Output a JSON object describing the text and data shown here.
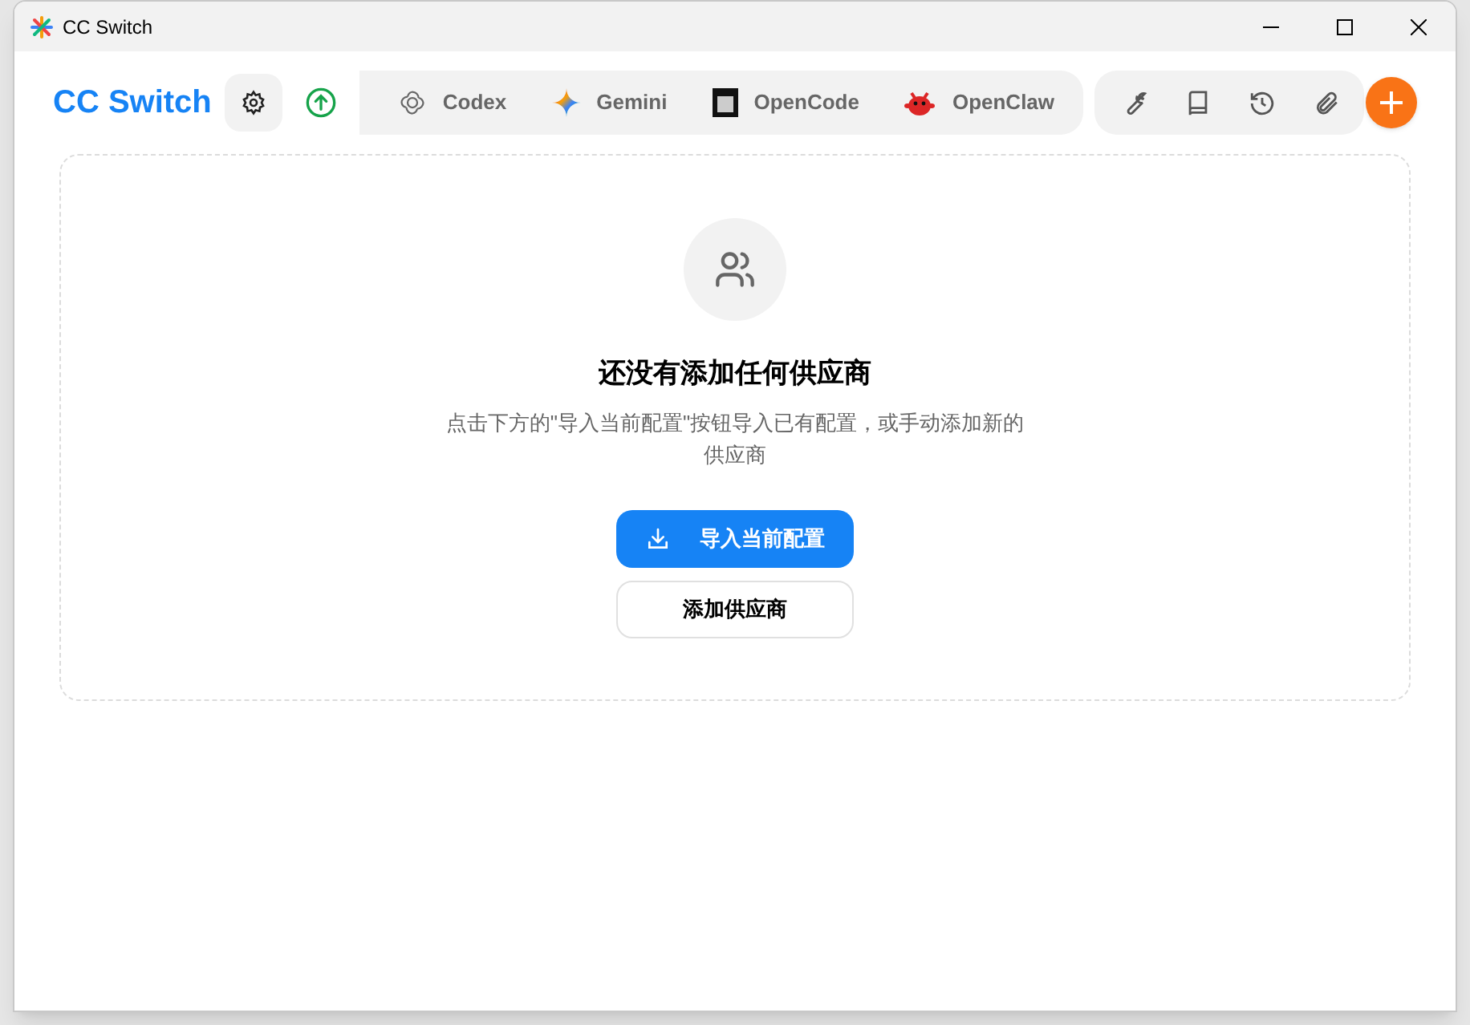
{
  "window": {
    "title": "CC Switch"
  },
  "header": {
    "logo": "CC Switch",
    "tabs": [
      {
        "label": "Codex",
        "kind": "codex"
      },
      {
        "label": "Gemini",
        "kind": "gemini"
      },
      {
        "label": "OpenCode",
        "kind": "opencode"
      },
      {
        "label": "OpenClaw",
        "kind": "openclaw"
      }
    ]
  },
  "empty_state": {
    "title": "还没有添加任何供应商",
    "description": "点击下方的\"导入当前配置\"按钮导入已有配置，或手动添加新的供应商",
    "buttons": [
      {
        "label": "导入当前配置",
        "kind": "primary"
      },
      {
        "label": "添加供应商",
        "kind": "secondary"
      }
    ]
  }
}
